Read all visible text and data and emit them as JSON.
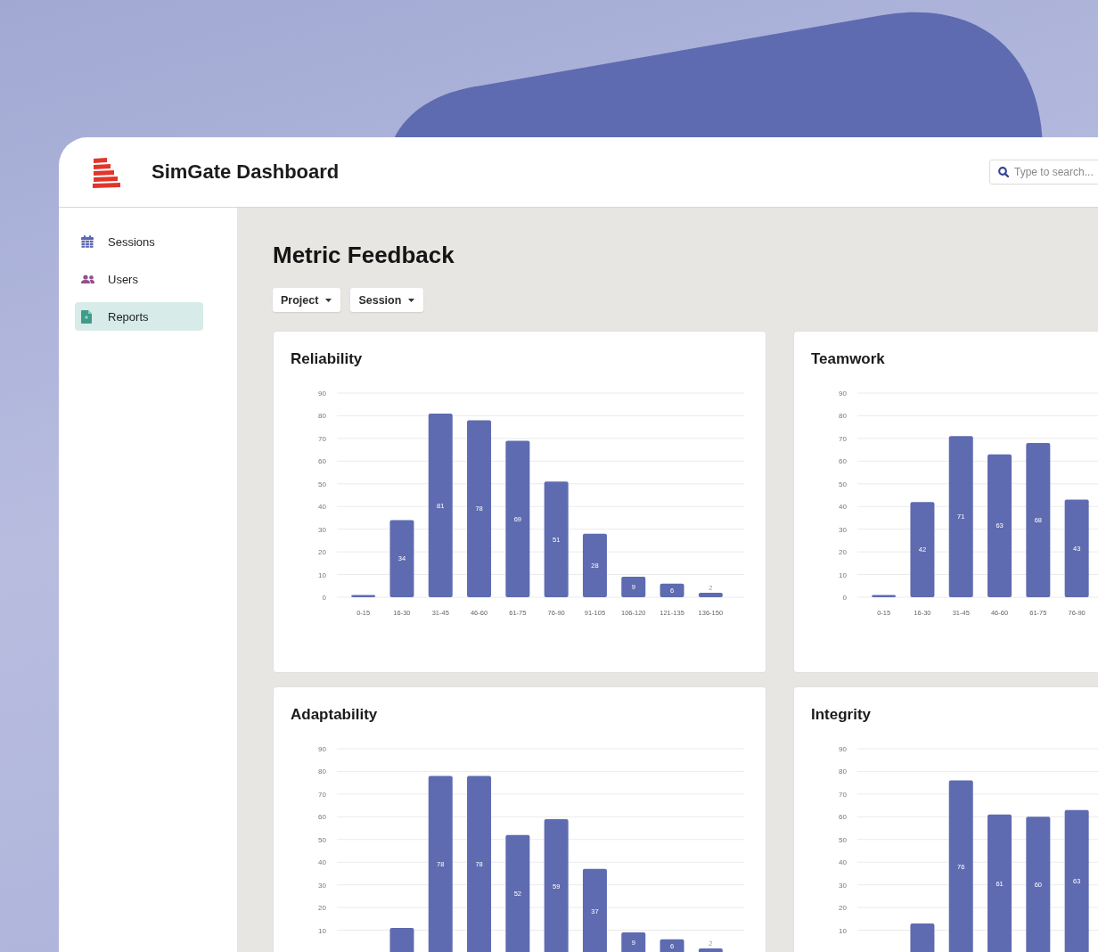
{
  "header": {
    "title": "SimGate Dashboard",
    "search": {
      "placeholder": "Type to search..."
    }
  },
  "sidebar": {
    "items": [
      {
        "label": "Sessions",
        "selected": false
      },
      {
        "label": "Users",
        "selected": false
      },
      {
        "label": "Reports",
        "selected": true
      }
    ]
  },
  "main": {
    "heading": "Metric Feedback",
    "filters": [
      {
        "label": "Project"
      },
      {
        "label": "Session"
      }
    ],
    "cards": [
      {
        "chart_data": {
          "type": "bar",
          "title": "Reliability",
          "categories": [
            "0-15",
            "16-30",
            "31-45",
            "46-60",
            "61-75",
            "76-90",
            "91-105",
            "106-120",
            "121-135",
            "136-150"
          ],
          "values": [
            1,
            34,
            81,
            78,
            69,
            51,
            28,
            9,
            6,
            2
          ],
          "value_labels": [
            null,
            "34",
            "81",
            "78",
            "69",
            "51",
            "28",
            "9",
            "6",
            "2"
          ],
          "ylim": [
            0,
            90
          ],
          "yticks": [
            0,
            10,
            20,
            30,
            40,
            50,
            60,
            70,
            80,
            90
          ],
          "grid": true
        }
      },
      {
        "chart_data": {
          "type": "bar",
          "title": "Teamwork",
          "categories": [
            "0-15",
            "16-30",
            "31-45",
            "46-60",
            "61-75",
            "76-90"
          ],
          "values": [
            1,
            42,
            71,
            63,
            68,
            43
          ],
          "value_labels": [
            null,
            "42",
            "71",
            "63",
            "68",
            "43"
          ],
          "ylim": [
            0,
            90
          ],
          "yticks": [
            0,
            10,
            20,
            30,
            40,
            50,
            60,
            70,
            80,
            90
          ],
          "grid": true
        }
      },
      {
        "chart_data": {
          "type": "bar",
          "title": "Adaptability",
          "values": [
            null,
            11,
            78,
            78,
            52,
            59,
            37,
            9,
            6,
            2
          ],
          "value_labels": [
            null,
            null,
            "78",
            "78",
            "52",
            "59",
            "37",
            "9",
            "6",
            "2"
          ],
          "ylim": [
            0,
            90
          ],
          "yticks": [
            10,
            20,
            30,
            40,
            50,
            60,
            70,
            80,
            90
          ],
          "grid": true
        }
      },
      {
        "chart_data": {
          "type": "bar",
          "title": "Integrity",
          "values": [
            null,
            13,
            76,
            61,
            60,
            63
          ],
          "value_labels": [
            null,
            null,
            "76",
            "61",
            "60",
            "63"
          ],
          "ylim": [
            0,
            90
          ],
          "yticks": [
            10,
            20,
            30,
            40,
            50,
            60,
            70,
            80,
            90
          ],
          "grid": true
        }
      }
    ]
  }
}
